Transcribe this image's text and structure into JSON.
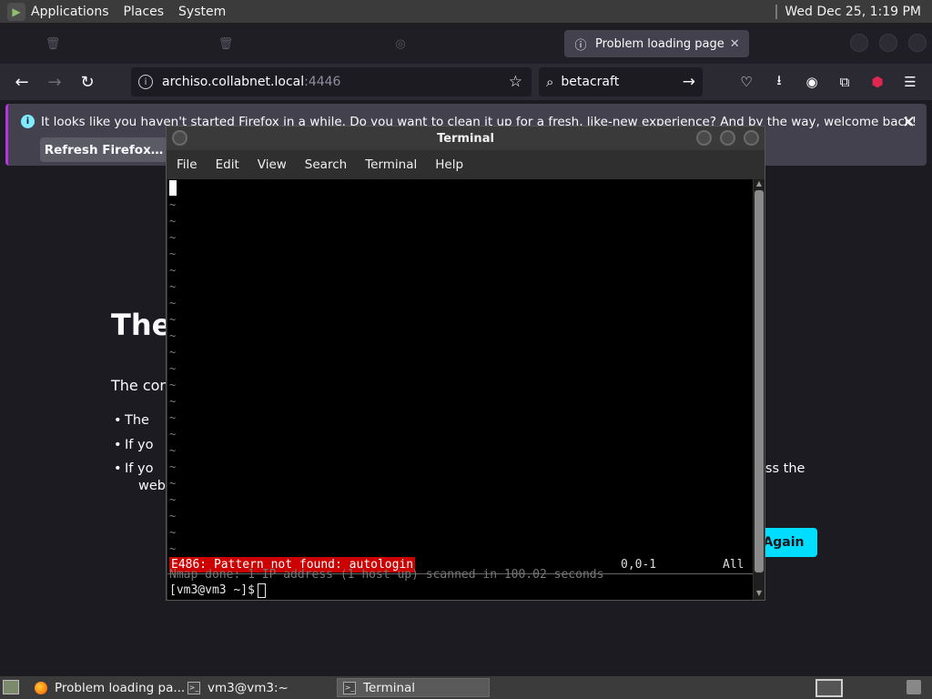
{
  "top_panel": {
    "menus": [
      "Applications",
      "Places",
      "System"
    ],
    "clock": "Wed Dec 25,  1:19 PM"
  },
  "browser": {
    "tabs": [
      {
        "label": "",
        "icon": "trash-icon"
      },
      {
        "label": "",
        "icon": "trash-icon"
      },
      {
        "label": "",
        "icon": "loading-icon"
      },
      {
        "label": "Problem loading page",
        "icon": "info-icon",
        "active": true
      }
    ],
    "url_host": "archiso.collabnet.local",
    "url_port": ":4446",
    "search_value": "betacraft",
    "notification": {
      "text": "It looks like you haven't started Firefox in a while. Do you want to clean it up for a fresh, like-new experience? And by the way, welcome back!",
      "button": "Refresh Firefox…"
    },
    "error_page": {
      "title": "The",
      "intro": "The con",
      "bullets": [
        "The",
        "If yo",
        "If yo"
      ],
      "bullet_cont": "web",
      "extra": "ess the",
      "try_again": "Again"
    }
  },
  "terminal": {
    "title": "Terminal",
    "menu": [
      "File",
      "Edit",
      "View",
      "Search",
      "Terminal",
      "Help"
    ],
    "vim_error": "E486: Pattern not found: autologin",
    "vim_position": "0,0-1",
    "vim_scroll": "All",
    "prev_output": "Nmap done: 1 IP address (1 host up) scanned in 100.02 seconds",
    "prompt": "[vm3@vm3 ~]$"
  },
  "taskbar": {
    "tasks": [
      {
        "label": "Problem loading pa...",
        "icon": "firefox-icon"
      },
      {
        "label": "vm3@vm3:~",
        "icon": "terminal-icon"
      },
      {
        "label": "Terminal",
        "icon": "terminal-icon",
        "active": true
      }
    ]
  },
  "colors": {
    "accent": "#00ddff",
    "vim_error_bg": "#cc0000",
    "notification_border": "#b833e1"
  }
}
